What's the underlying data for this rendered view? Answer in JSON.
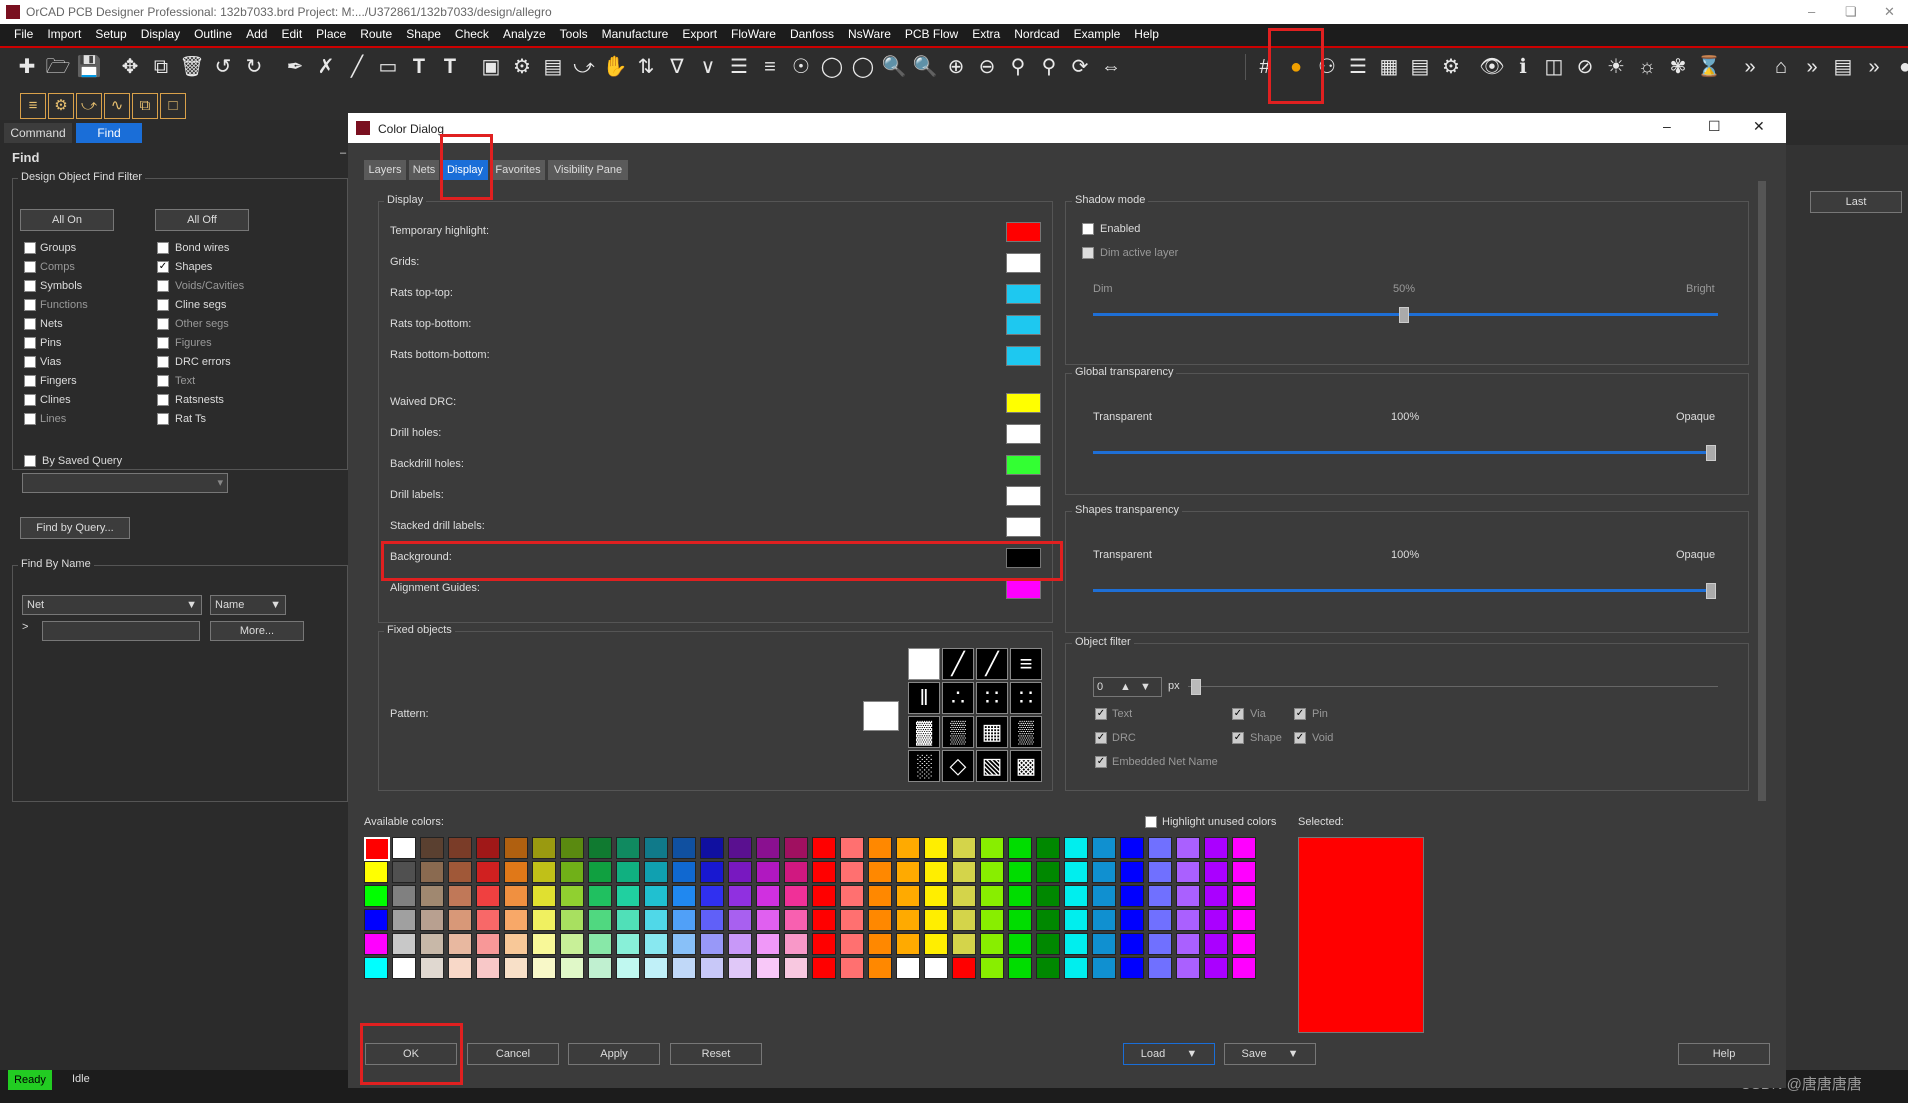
{
  "window": {
    "title": "OrCAD PCB Designer Professional: 132b7033.brd  Project: M:.../U372861/132b7033/design/allegro"
  },
  "menu": [
    "File",
    "Import",
    "Setup",
    "Display",
    "Outline",
    "Add",
    "Edit",
    "Place",
    "Route",
    "Shape",
    "Check",
    "Analyze",
    "Tools",
    "Manufacture",
    "Export",
    "FloWare",
    "Danfoss",
    "NsWare",
    "PCB Flow",
    "Extra",
    "Nordcad",
    "Example",
    "Help"
  ],
  "left_tabs": {
    "command": "Command",
    "find": "Find"
  },
  "find": {
    "title": "Find",
    "filter_title": "Design Object Find Filter",
    "all_on": "All On",
    "all_off": "All Off",
    "left_items": [
      {
        "label": "Groups",
        "checked": false,
        "dim": false
      },
      {
        "label": "Comps",
        "checked": false,
        "dim": true
      },
      {
        "label": "Symbols",
        "checked": false,
        "dim": false
      },
      {
        "label": "Functions",
        "checked": false,
        "dim": true
      },
      {
        "label": "Nets",
        "checked": false,
        "dim": false
      },
      {
        "label": "Pins",
        "checked": false,
        "dim": false
      },
      {
        "label": "Vias",
        "checked": false,
        "dim": false
      },
      {
        "label": "Fingers",
        "checked": false,
        "dim": false
      },
      {
        "label": "Clines",
        "checked": false,
        "dim": false
      },
      {
        "label": "Lines",
        "checked": false,
        "dim": true
      }
    ],
    "right_items": [
      {
        "label": "Bond wires",
        "checked": false,
        "dim": false
      },
      {
        "label": "Shapes",
        "checked": true,
        "dim": false
      },
      {
        "label": "Voids/Cavities",
        "checked": false,
        "dim": true
      },
      {
        "label": "Cline segs",
        "checked": false,
        "dim": false
      },
      {
        "label": "Other segs",
        "checked": false,
        "dim": true
      },
      {
        "label": "Figures",
        "checked": false,
        "dim": true
      },
      {
        "label": "DRC errors",
        "checked": false,
        "dim": false
      },
      {
        "label": "Text",
        "checked": false,
        "dim": true
      },
      {
        "label": "Ratsnests",
        "checked": false,
        "dim": false
      },
      {
        "label": "Rat Ts",
        "checked": false,
        "dim": false
      }
    ],
    "by_saved_query": "By Saved Query",
    "find_by_query": "Find by Query...",
    "find_by_name": "Find By Name",
    "net_select": "Net",
    "name_select": "Name",
    "prompt": ">",
    "more": "More..."
  },
  "status": {
    "ready": "Ready",
    "idle": "Idle"
  },
  "dialog": {
    "title": "Color Dialog",
    "tabs": [
      "Layers",
      "Nets",
      "Display",
      "Favorites",
      "Visibility Pane"
    ],
    "active_tab": "Display",
    "display_group": "Display",
    "display_items": [
      {
        "label": "Temporary highlight:",
        "color": "#ff0000"
      },
      {
        "label": "Grids:",
        "color": "#ffffff"
      },
      {
        "label": "Rats top-top:",
        "color": "#1ec8f0"
      },
      {
        "label": "Rats top-bottom:",
        "color": "#1ec8f0"
      },
      {
        "label": "Rats bottom-bottom:",
        "color": "#1ec8f0"
      },
      {
        "label": "Waived DRC:",
        "color": "#ffff00"
      },
      {
        "label": "Drill holes:",
        "color": "#ffffff"
      },
      {
        "label": "Backdrill holes:",
        "color": "#33ff33"
      },
      {
        "label": "Drill labels:",
        "color": "#ffffff"
      },
      {
        "label": "Stacked drill labels:",
        "color": "#ffffff"
      },
      {
        "label": "Background:",
        "color": "#000000"
      },
      {
        "label": "Alignment Guides:",
        "color": "#ff00ff"
      }
    ],
    "fixed_objects": "Fixed objects",
    "pattern": "Pattern:",
    "shadow_mode": {
      "title": "Shadow mode",
      "enabled": "Enabled",
      "dim_active_layer": "Dim active layer",
      "dim": "Dim",
      "value": "50%",
      "bright": "Bright",
      "level": 0.5
    },
    "global_transparency": {
      "title": "Global transparency",
      "left": "Transparent",
      "value": "100%",
      "right": "Opaque",
      "level": 1.0
    },
    "shapes_transparency": {
      "title": "Shapes transparency",
      "left": "Transparent",
      "value": "100%",
      "right": "Opaque",
      "level": 1.0
    },
    "object_filter": {
      "title": "Object filter",
      "px_value": "0",
      "px": "px",
      "text": "Text",
      "via": "Via",
      "pin": "Pin",
      "drc": "DRC",
      "shape": "Shape",
      "void": "Void",
      "embedded": "Embedded Net Name"
    },
    "available_colors": "Available colors:",
    "highlight_unused": "Highlight unused colors",
    "selected_label": "Selected:",
    "selected_color": "#ff0000",
    "buttons": {
      "ok": "OK",
      "cancel": "Cancel",
      "apply": "Apply",
      "reset": "Reset",
      "load": "Load",
      "save": "Save",
      "help": "Help"
    },
    "palette": [
      [
        "#ff0000",
        "#ffffff",
        "#5a4030",
        "#7a3c28",
        "#a01818",
        "#b06010",
        "#9a9a10",
        "#5a8a10",
        "#107a30",
        "#108a60",
        "#107a8a",
        "#1050a0",
        "#1010a0",
        "#5a1090",
        "#8a1090",
        "#a01060",
        "#ff0000",
        "#ff7070",
        "#ff8800",
        "#ffaa00",
        "#ffee00",
        "#d4d44a",
        "#88ee00",
        "#00dd00",
        "#008800",
        "#00eeee",
        "#1090d0",
        "#0000ff",
        "#7070ff",
        "#aa60ff",
        "#aa00ff",
        "#ff00ff"
      ],
      [
        "#ffff00",
        "#505050",
        "#8a6a50",
        "#a05838",
        "#d02020",
        "#e07818",
        "#c0c018",
        "#70b018",
        "#10a040",
        "#10b080",
        "#10a0b0",
        "#1068d0",
        "#1818d0",
        "#7818c0",
        "#b018c0",
        "#d01880",
        "#ff0000",
        "#ff7070",
        "#ff8800",
        "#ffaa00",
        "#ffee00",
        "#d4d44a",
        "#88ee00",
        "#00dd00",
        "#008800",
        "#00eeee",
        "#1090d0",
        "#0000ff",
        "#7070ff",
        "#aa60ff",
        "#aa00ff",
        "#ff00ff"
      ],
      [
        "#00ff00",
        "#808080",
        "#a08870",
        "#c07858",
        "#f04040",
        "#f09040",
        "#e0e030",
        "#90d030",
        "#20c060",
        "#20d0a0",
        "#20c0d0",
        "#2088f0",
        "#3030f0",
        "#9030e0",
        "#d030e0",
        "#f03098",
        "#ff0000",
        "#ff7070",
        "#ff8800",
        "#ffaa00",
        "#ffee00",
        "#d4d44a",
        "#88ee00",
        "#00dd00",
        "#008800",
        "#00eeee",
        "#1090d0",
        "#0000ff",
        "#7070ff",
        "#aa60ff",
        "#aa00ff",
        "#ff00ff"
      ],
      [
        "#0000ff",
        "#a0a0a0",
        "#b8a090",
        "#d89878",
        "#f86868",
        "#f8a868",
        "#f0f060",
        "#a8e060",
        "#50d880",
        "#50e0b8",
        "#50d8e8",
        "#50a0f8",
        "#6060f8",
        "#a860f0",
        "#e060f0",
        "#f860b0",
        "#ff0000",
        "#ff7070",
        "#ff8800",
        "#ffaa00",
        "#ffee00",
        "#d4d44a",
        "#88ee00",
        "#00dd00",
        "#008800",
        "#00eeee",
        "#1090d0",
        "#0000ff",
        "#7070ff",
        "#aa60ff",
        "#aa00ff",
        "#ff00ff"
      ],
      [
        "#ff00ff",
        "#c8c8c8",
        "#c8b8a8",
        "#e8b8a0",
        "#f89898",
        "#f8c898",
        "#f8f898",
        "#c8f098",
        "#88e8a8",
        "#88f0d8",
        "#88e8f0",
        "#88c0f8",
        "#9898f8",
        "#c898f8",
        "#f098f8",
        "#f898c8",
        "#ff0000",
        "#ff7070",
        "#ff8800",
        "#ffaa00",
        "#ffee00",
        "#d4d44a",
        "#88ee00",
        "#00dd00",
        "#008800",
        "#00eeee",
        "#1090d0",
        "#0000ff",
        "#7070ff",
        "#aa60ff",
        "#aa00ff",
        "#ff00ff"
      ],
      [
        "#00ffff",
        "#ffffff",
        "#e0d8d0",
        "#f8d8c8",
        "#f8c8c8",
        "#f8e0c8",
        "#f8f8c8",
        "#e0f8c8",
        "#c0f0d0",
        "#c0f8f0",
        "#c0f0f8",
        "#c0d8f8",
        "#c8c8f8",
        "#e0c8f8",
        "#f8c8f8",
        "#f8c8e0",
        "#ff0000",
        "#ff7070",
        "#ff8800",
        "#ffffff",
        "#ffffff",
        "#ff0000",
        "#88ee00",
        "#00dd00",
        "#008800",
        "#00eeee",
        "#1090d0",
        "#0000ff",
        "#7070ff",
        "#aa60ff",
        "#aa00ff",
        "#ff00ff"
      ]
    ]
  },
  "right_panel": {
    "last": "Last"
  },
  "watermark": "CSDN @唐唐唐唐"
}
